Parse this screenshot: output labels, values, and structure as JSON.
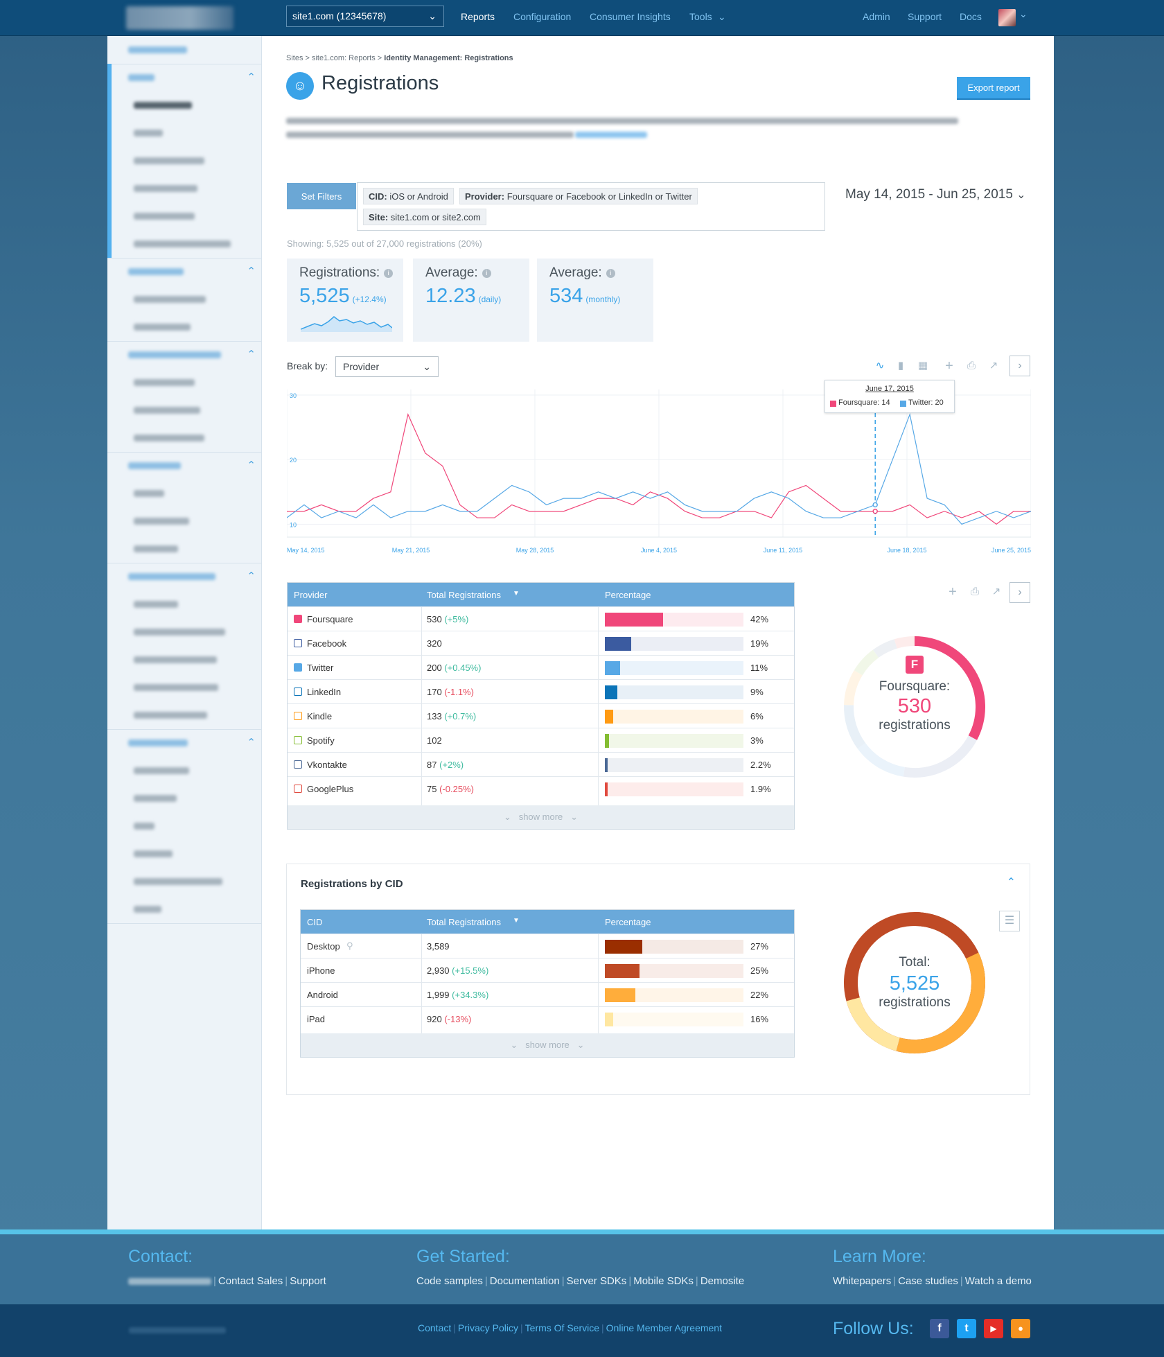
{
  "topbar": {
    "site_select": "site1.com (12345678)",
    "nav": [
      "Reports",
      "Configuration",
      "Consumer Insights",
      "Tools"
    ],
    "right_nav": [
      "Admin",
      "Support",
      "Docs"
    ]
  },
  "breadcrumb": {
    "prefix": "Sites > site1.com: Reports > ",
    "current": "Identity Management: Registrations"
  },
  "page": {
    "title": "Registrations",
    "export_label": "Export report"
  },
  "filters": {
    "button": "Set Filters",
    "chips": [
      {
        "key": "CID:",
        "value": " iOS or Android"
      },
      {
        "key": "Provider:",
        "value": " Foursquare or Facebook or LinkedIn or Twitter"
      },
      {
        "key": "Site:",
        "value": " site1.com or site2.com"
      }
    ],
    "date_range": "May 14, 2015 - Jun 25, 2015"
  },
  "showing": "Showing: 5,525 out of 27,000 registrations (20%)",
  "stats": [
    {
      "label": "Registrations:",
      "value": "5,525",
      "note": "(+12.4%)"
    },
    {
      "label": "Average:",
      "value": "12.23",
      "note": "(daily)"
    },
    {
      "label": "Average:",
      "value": "534",
      "note": "(monthly)"
    }
  ],
  "breakby": {
    "label": "Break by:",
    "value": "Provider"
  },
  "chart_data": {
    "type": "line",
    "x_ticks": [
      "May 14, 2015",
      "May 21, 2015",
      "May 28, 2015",
      "June 4, 2015",
      "June 11, 2015",
      "June 18, 2015",
      "June 25, 2015"
    ],
    "y_ticks": [
      10,
      20,
      30
    ],
    "ylim": [
      8,
      30
    ],
    "series": [
      {
        "name": "Foursquare",
        "color": "#f0477a",
        "values": [
          12,
          12,
          13,
          12,
          12,
          14,
          15,
          27,
          21,
          19,
          13,
          11,
          11,
          13,
          12,
          12,
          12,
          13,
          14,
          14,
          13,
          15,
          14,
          12,
          11,
          11,
          12,
          12,
          11,
          15,
          16,
          14,
          12,
          12,
          12,
          12,
          13,
          11,
          12,
          11,
          12,
          10,
          12,
          12
        ]
      },
      {
        "name": "Twitter",
        "color": "#57a8e6",
        "values": [
          11,
          13,
          11,
          12,
          11,
          13,
          11,
          12,
          12,
          13,
          12,
          12,
          14,
          16,
          15,
          13,
          14,
          14,
          15,
          14,
          15,
          14,
          15,
          13,
          12,
          12,
          12,
          14,
          15,
          14,
          12,
          11,
          11,
          12,
          13,
          20,
          27,
          14,
          13,
          10,
          11,
          12,
          11,
          12
        ]
      }
    ],
    "tooltip": {
      "date": "June 17, 2015",
      "items": [
        "Foursquare: 14",
        "Twitter: 20"
      ]
    }
  },
  "provider_table": {
    "headers": [
      "Provider",
      "Total Registrations",
      "Percentage"
    ],
    "rows": [
      {
        "name": "Foursquare",
        "total": "530",
        "change": "(+5%)",
        "trend": "pos",
        "pct": "42%",
        "frac": 0.42,
        "color": "#f0477a",
        "bg": "#fdebef",
        "filled": true
      },
      {
        "name": "Facebook",
        "total": "320",
        "change": "",
        "trend": "",
        "pct": "19%",
        "frac": 0.19,
        "color": "#3b5ba0",
        "bg": "#ebeef5",
        "filled": false
      },
      {
        "name": "Twitter",
        "total": "200",
        "change": "(+0.45%)",
        "trend": "pos",
        "pct": "11%",
        "frac": 0.11,
        "color": "#57a8e6",
        "bg": "#eaf3fb",
        "filled": true
      },
      {
        "name": "LinkedIn",
        "total": "170",
        "change": "(-1.1%)",
        "trend": "neg",
        "pct": "9%",
        "frac": 0.09,
        "color": "#0b74b8",
        "bg": "#e8f0f7",
        "filled": false
      },
      {
        "name": "Kindle",
        "total": "133",
        "change": "(+0.7%)",
        "trend": "pos",
        "pct": "6%",
        "frac": 0.06,
        "color": "#ff9a13",
        "bg": "#fff4e5",
        "filled": false
      },
      {
        "name": "Spotify",
        "total": "102",
        "change": "",
        "trend": "",
        "pct": "3%",
        "frac": 0.03,
        "color": "#84bd32",
        "bg": "#f1f7e8",
        "filled": false
      },
      {
        "name": "Vkontakte",
        "total": "87",
        "change": "(+2%)",
        "trend": "pos",
        "pct": "2.2%",
        "frac": 0.022,
        "color": "#4a6895",
        "bg": "#edf0f4",
        "filled": false
      },
      {
        "name": "GooglePlus",
        "total": "75",
        "change": "(-0.25%)",
        "trend": "neg",
        "pct": "1.9%",
        "frac": 0.019,
        "color": "#e04a3f",
        "bg": "#fdeceb",
        "filled": false
      }
    ],
    "show_more": "show more"
  },
  "provider_donut": {
    "label": "Foursquare:",
    "value": "530",
    "unit": "registrations",
    "highlight_color": "#f0477a"
  },
  "cid_panel": {
    "title": "Registrations by CID",
    "headers": [
      "CID",
      "Total Registrations",
      "Percentage"
    ],
    "rows": [
      {
        "name": "Desktop",
        "total": "3,589",
        "change": "",
        "trend": "",
        "pct": "27%",
        "frac": 0.27,
        "color": "#9a2e00",
        "bg": "#f5eae5"
      },
      {
        "name": "iPhone",
        "total": "2,930",
        "change": "(+15.5%)",
        "trend": "pos",
        "pct": "25%",
        "frac": 0.25,
        "color": "#bf4a25",
        "bg": "#f8ece8"
      },
      {
        "name": "Android",
        "total": "1,999",
        "change": "(+34.3%)",
        "trend": "pos",
        "pct": "22%",
        "frac": 0.22,
        "color": "#ffad3b",
        "bg": "#fff5e8"
      },
      {
        "name": "iPad",
        "total": "920",
        "change": "(-13%)",
        "trend": "neg",
        "pct": "16%",
        "frac": 0.06,
        "color": "#ffe7a1",
        "bg": "#fffaf0"
      }
    ],
    "show_more": "show more",
    "donut": {
      "label": "Total:",
      "value": "5,525",
      "unit": "registrations"
    }
  },
  "footer": {
    "contact_head": "Contact:",
    "contact_links": [
      "Contact Sales",
      "Support"
    ],
    "started_head": "Get Started:",
    "started_links": [
      "Code samples",
      "Documentation",
      "Server SDKs",
      "Mobile SDKs",
      "Demosite"
    ],
    "learn_head": "Learn More:",
    "learn_links": [
      "Whitepapers",
      "Case studies",
      "Watch a demo"
    ],
    "bottom_links": [
      "Contact",
      "Privacy Policy",
      "Terms Of Service",
      "Online Member Agreement"
    ],
    "follow": "Follow Us:",
    "social": {
      "facebook": "#3b5998",
      "twitter": "#1da1f2",
      "youtube": "#e52d27",
      "rss": "#f7931e"
    }
  }
}
